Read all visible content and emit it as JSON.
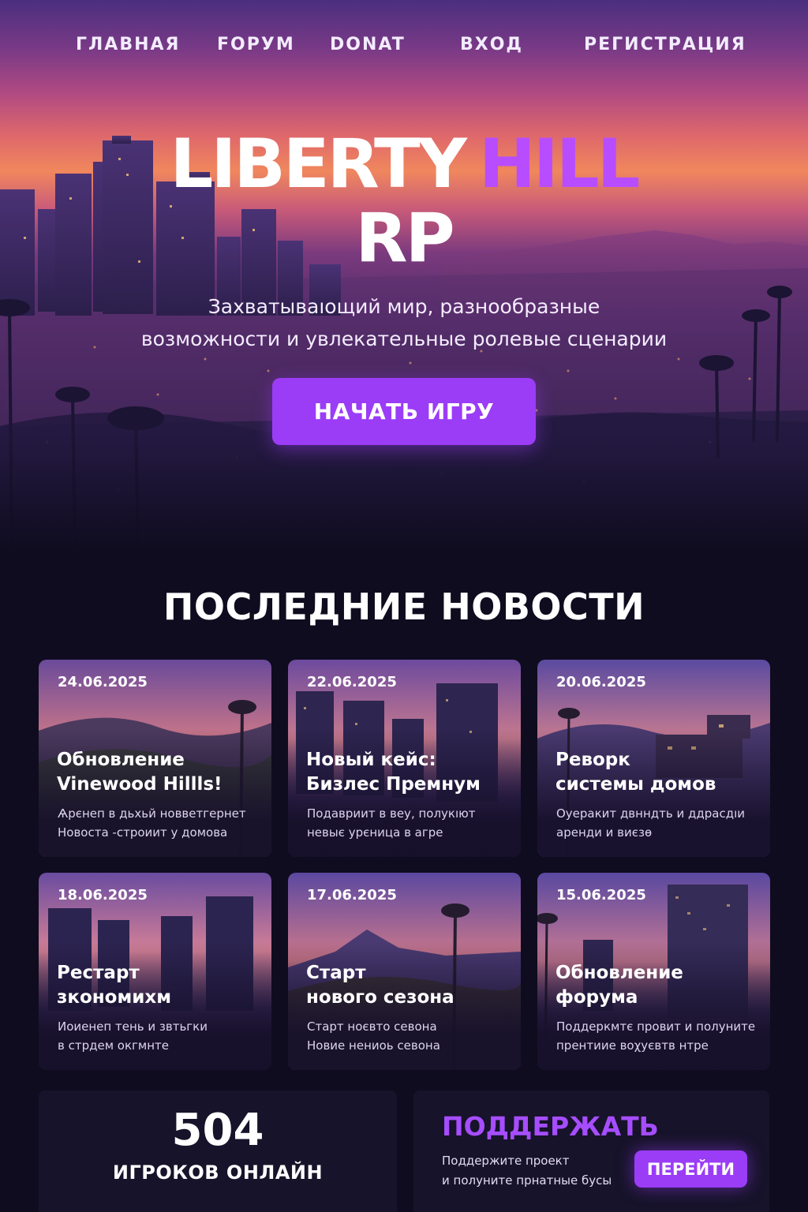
{
  "nav": {
    "items": [
      {
        "label": "ГЛАВНАЯ"
      },
      {
        "label": "FОРУМ"
      },
      {
        "label": "DONAT"
      },
      {
        "label": "ВХОД"
      },
      {
        "label": "РЕГИСТРАЦИЯ"
      }
    ]
  },
  "hero": {
    "title_word1": "LIBERTY",
    "title_word2": "HILL",
    "title_line2": "RP",
    "subtitle": "Захватываıощий мир, разнообразные\nвозможности и увлекательные ролевые сценарии",
    "cta_label": "НАЧАТЬ ИГРУ"
  },
  "news": {
    "heading": "ПОСЛЕДНИЕ НОВОСТИ",
    "cards": [
      {
        "date": "24.06.2025",
        "title": "Обновление\nVinewood Hillls!",
        "desc": "Ѧрєнеп в дьхьй новветгернет\nНовоста -строиит у домова"
      },
      {
        "date": "22.06.2025",
        "title": "Новый кейс:\nБизлес Премнум",
        "desc": "Подавриит в веу, полукıют\nневыє урєница в агре"
      },
      {
        "date": "20.06.2025",
        "title": "Реворк\nсистемы домов",
        "desc": "Оуеракит двнндть и ддрасдıи\nаренди и виєзѳ"
      },
      {
        "date": "18.06.2025",
        "title": "Рестарт\nзкономихм",
        "desc": "Иоиенеп тень и звтьгки\nв стрдем окгмнте"
      },
      {
        "date": "17.06.2025",
        "title": "Старт\nнового сезона",
        "desc": "Старт ноєвто севона\nНовие нениоь севона"
      },
      {
        "date": "15.06.2025",
        "title": "Обновление\nфорума",
        "desc": "Поддеркмтє провит и полуните\nпрентиие воχуєвтв нтре"
      }
    ]
  },
  "online": {
    "count": "504",
    "label": "ИГРОКОВ ОНЛАЙН"
  },
  "support": {
    "title": "ПОДДЕРЖАТЬ",
    "desc": "Поддержите проект\nи полуните прнатные бусы",
    "button_label": "ПЕРЕЙТИ"
  },
  "colors": {
    "accent": "#9b3cf7",
    "accent_text": "#b84dff",
    "background": "#0f0c1f",
    "panel": "#17132a"
  }
}
